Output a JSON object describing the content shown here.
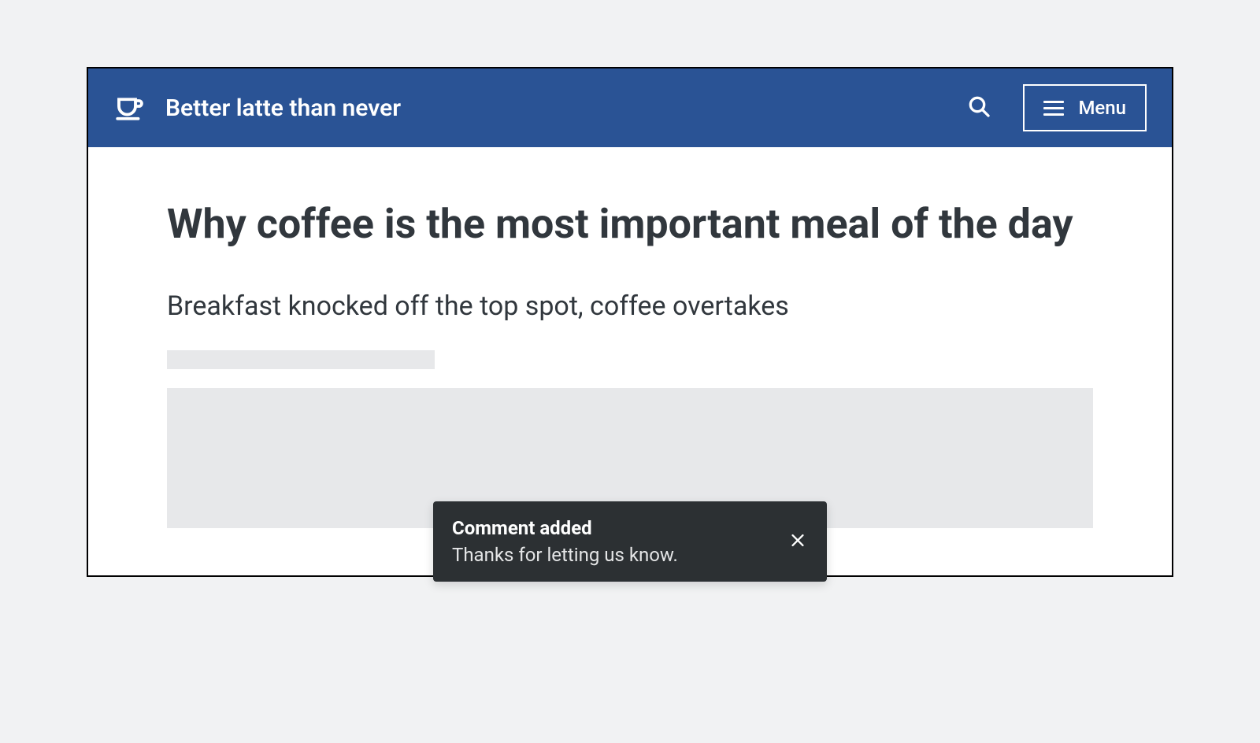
{
  "header": {
    "site_title": "Better latte than never",
    "menu_label": "Menu"
  },
  "article": {
    "title": "Why coffee is the most important meal of the day",
    "subtitle": "Breakfast knocked off the top spot, coffee overtakes"
  },
  "toast": {
    "title": "Comment added",
    "body": "Thanks for letting us know."
  }
}
